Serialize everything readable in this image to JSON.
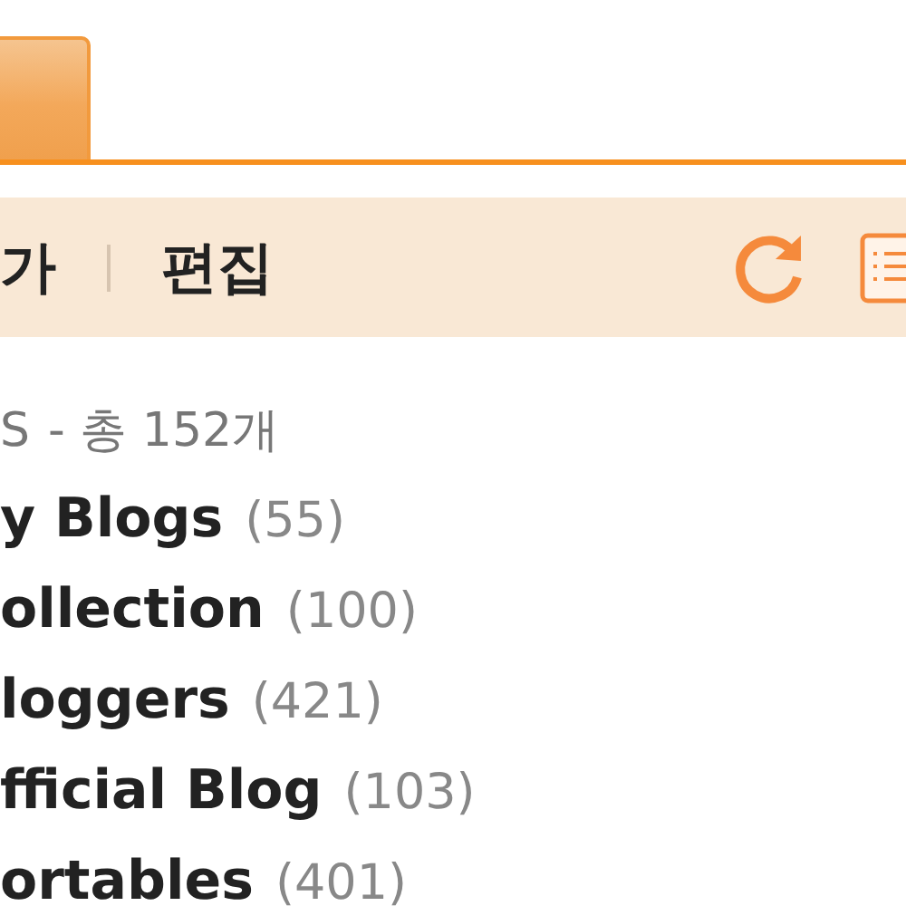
{
  "toolbar": {
    "actions": [
      {
        "label": "가"
      },
      {
        "label": "편집"
      }
    ]
  },
  "list": {
    "header": {
      "title": "S",
      "summary": "- 총 152개"
    },
    "items": [
      {
        "name": "y Blogs",
        "count": "(55)"
      },
      {
        "name": "ollection",
        "count": "(100)"
      },
      {
        "name": "loggers",
        "count": "(421)"
      },
      {
        "name": "fficial Blog",
        "count": "(103)"
      },
      {
        "name": "ortables",
        "count": "(401)"
      }
    ]
  }
}
